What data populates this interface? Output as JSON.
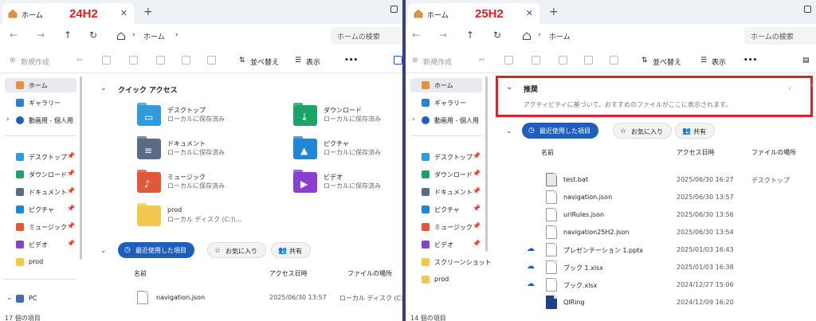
{
  "left": {
    "tab_title": "ホーム",
    "version_label": "24H2",
    "address_crumb": "ホーム",
    "search_placeholder": "ホームの検索",
    "toolbar": {
      "new": "新規作成",
      "sort": "並べ替え",
      "view": "表示"
    },
    "sidebar": {
      "top": [
        {
          "label": "ホーム"
        },
        {
          "label": "ギャラリー"
        },
        {
          "label": "動画用 - 個人用"
        }
      ],
      "pinned": [
        {
          "label": "デスクトップ"
        },
        {
          "label": "ダウンロード"
        },
        {
          "label": "ドキュメント"
        },
        {
          "label": "ピクチャ"
        },
        {
          "label": "ミュージック"
        },
        {
          "label": "ビデオ"
        },
        {
          "label": "prod"
        }
      ],
      "pc": "PC",
      "status": "17 個の項目"
    },
    "quick_access": {
      "title": "クイック アクセス",
      "items": [
        {
          "name": "デスクトップ",
          "sub": "ローカルに保存済み"
        },
        {
          "name": "ダウンロード",
          "sub": "ローカルに保存済み"
        },
        {
          "name": "ドキュメント",
          "sub": "ローカルに保存済み"
        },
        {
          "name": "ピクチャ",
          "sub": "ローカルに保存済み"
        },
        {
          "name": "ミュージック",
          "sub": "ローカルに保存済み"
        },
        {
          "name": "ビデオ",
          "sub": "ローカルに保存済み"
        },
        {
          "name": "prod",
          "sub": "ローカル ディスク (C:)\\..."
        }
      ]
    },
    "tabs": {
      "recent": "最近使用した項目",
      "favorites": "お気に入り",
      "shared": "共有"
    },
    "columns": {
      "name": "名前",
      "date": "アクセス日時",
      "location": "ファイルの場所"
    },
    "files": [
      {
        "name": "navigation.json",
        "date": "2025/06/30 13:57",
        "location": "ローカル ディスク (C:)\\..."
      }
    ]
  },
  "right": {
    "tab_title": "ホーム",
    "version_label": "25H2",
    "address_crumb": "ホーム",
    "search_placeholder": "ホームの検索",
    "toolbar": {
      "new": "新規作成",
      "sort": "並べ替え",
      "view": "表示"
    },
    "sidebar": {
      "top": [
        {
          "label": "ホーム"
        },
        {
          "label": "ギャラリー"
        },
        {
          "label": "動画用 - 個人用"
        }
      ],
      "pinned": [
        {
          "label": "デスクトップ"
        },
        {
          "label": "ダウンロード"
        },
        {
          "label": "ドキュメント"
        },
        {
          "label": "ピクチャ"
        },
        {
          "label": "ミュージック"
        },
        {
          "label": "ビデオ"
        },
        {
          "label": "スクリーンショット"
        },
        {
          "label": "prod"
        }
      ],
      "status": "14 個の項目"
    },
    "recommended": {
      "title": "推奨",
      "subtitle": "アクティビティに基づいて、おすすめのファイルがここに表示されます。"
    },
    "tabs": {
      "recent": "最近使用した項目",
      "favorites": "お気に入り",
      "shared": "共有"
    },
    "columns": {
      "name": "名前",
      "date": "アクセス日時",
      "location": "ファイルの場所"
    },
    "files": [
      {
        "name": "test.bat",
        "date": "2025/06/30 16:27",
        "location": "デスクトップ"
      },
      {
        "name": "navigation.json",
        "date": "2025/06/30 13:57",
        "location": ""
      },
      {
        "name": "uriRules.json",
        "date": "2025/06/30 13:56",
        "location": ""
      },
      {
        "name": "navigation25H2.json",
        "date": "2025/06/30 13:54",
        "location": ""
      },
      {
        "name": "プレゼンテーション 1.pptx",
        "date": "2025/01/03 16:43",
        "location": ""
      },
      {
        "name": "ブック 1.xlsx",
        "date": "2025/01/03 16:38",
        "location": ""
      },
      {
        "name": "ブック.xlsx",
        "date": "2024/12/27 15:06",
        "location": ""
      },
      {
        "name": "QIRing",
        "date": "2024/12/09 16:20",
        "location": ""
      }
    ]
  },
  "colors": {
    "accent": "#1e5fbd",
    "highlight": "#e0202a",
    "version_label": "#e02020"
  }
}
